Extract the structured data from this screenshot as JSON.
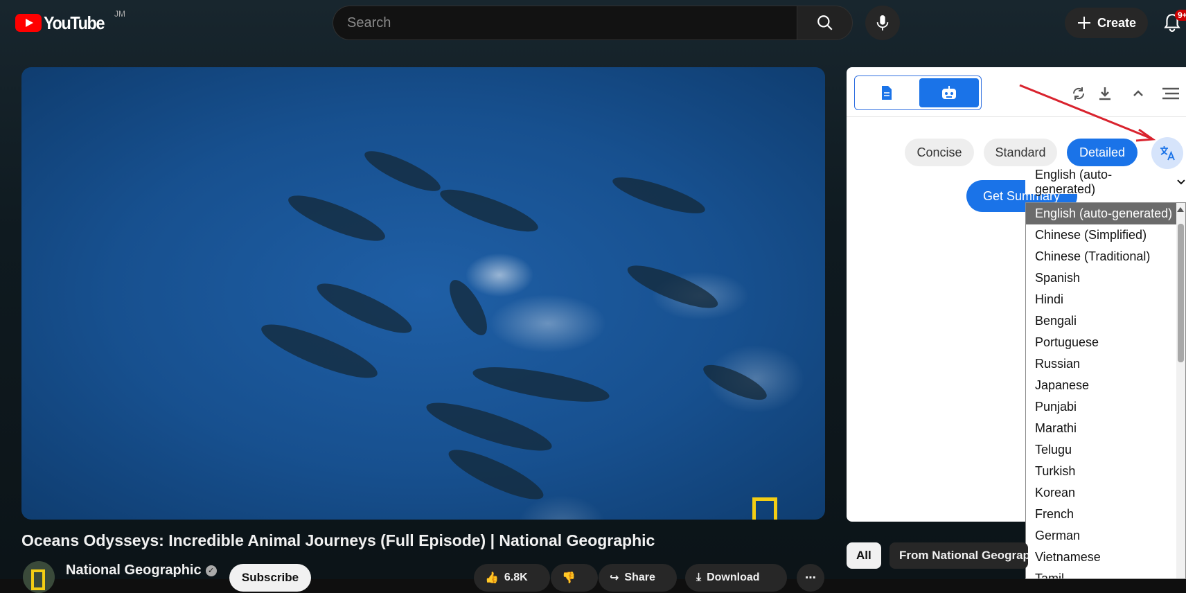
{
  "header": {
    "logo_text": "YouTube",
    "logo_country": "JM",
    "search_placeholder": "Search",
    "create_label": "Create",
    "notification_count": "9+"
  },
  "video": {
    "title": "Oceans Odysseys: Incredible Animal Journeys (Full Episode) | National Geographic",
    "channel_name": "National Geographic",
    "subscribe_label": "Subscribe",
    "like_count": "6.8K",
    "share_label": "Share",
    "download_label": "Download"
  },
  "summary_panel": {
    "modes": [
      "Concise",
      "Standard",
      "Detailed"
    ],
    "active_mode": "Detailed",
    "get_summary_label": "Get Summary",
    "selected_language": "English (auto-generated)",
    "languages": [
      "English (auto-generated)",
      "Chinese (Simplified)",
      "Chinese (Traditional)",
      "Spanish",
      "Hindi",
      "Bengali",
      "Portuguese",
      "Russian",
      "Japanese",
      "Punjabi",
      "Marathi",
      "Telugu",
      "Turkish",
      "Korean",
      "French",
      "German",
      "Vietnamese",
      "Tamil"
    ]
  },
  "filters": {
    "all_label": "All",
    "channel_chip_label": "From National Geographic"
  },
  "colors": {
    "accent": "#1a73e8",
    "youtube_red": "#ff0000",
    "annotation_arrow": "#d9232e"
  }
}
